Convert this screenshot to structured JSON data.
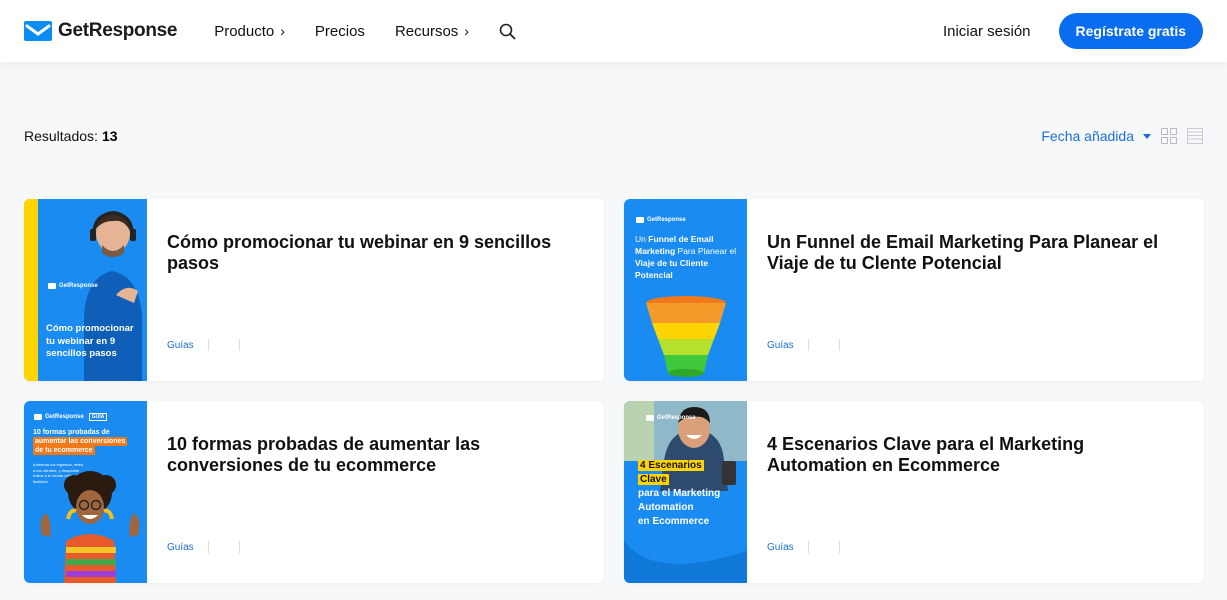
{
  "header": {
    "brand": "GetResponse",
    "nav": [
      {
        "label": "Producto",
        "chevron": "›"
      },
      {
        "label": "Precios",
        "chevron": ""
      },
      {
        "label": "Recursos",
        "chevron": "›"
      }
    ],
    "login": "Iniciar sesión",
    "cta": "Regístrate gratis"
  },
  "results": {
    "label": "Resultados:",
    "count": "13",
    "sort": "Fecha añadida",
    "views": [
      "grid-view-icon",
      "list-view-icon"
    ]
  },
  "cards": [
    {
      "title": "Cómo promocionar tu webinar en 9 sencillos pasos⁣",
      "tag": "Guías",
      "thumb": {
        "brand": "GetResponse",
        "text": "Cómo promocionar tu webinar en 9 sencillos pasos"
      }
    },
    {
      "title": "Un Funnel de Email Marketing Para Planear el Viaje de tu Clente Potencial",
      "tag": "Guías",
      "thumb": {
        "brand": "GetResponse",
        "text_a": "Un",
        "text_b": "Funnel de Email Marketing",
        "text_c": "Para Planear el",
        "text_d": "Viaje de tu Cliente Potencial"
      }
    },
    {
      "title": "10 formas probadas de aumentar las conversiones de tu ecommerce",
      "tag": "Guías",
      "thumb": {
        "brand": "GetResponse",
        "badge": "GUÍA",
        "line1": "10 formas probadas de",
        "line2": "aumentar las conversiones",
        "line3": "de tu ecommerce",
        "sub": "Aumenta tus ingresos, retén a tus clientes, y despídete bollos a tu tienda online con facilidad"
      }
    },
    {
      "title": "4 Escenarios Clave para el Marketing Automation en Ecommerce",
      "tag": "Guías",
      "thumb": {
        "brand": "GetResponse",
        "hl1": "4 Escenarios",
        "hl2": "Clave",
        "rest1": "para el Marketing",
        "rest2": "Automation",
        "rest3": "en Ecommerce"
      }
    }
  ],
  "colors": {
    "accent": "#0a6df0",
    "link": "#1a6fd8",
    "page_bg": "#f7f8fa",
    "thumb_blue": "#1a8bf0",
    "thumb_yellow": "#ffd400"
  }
}
